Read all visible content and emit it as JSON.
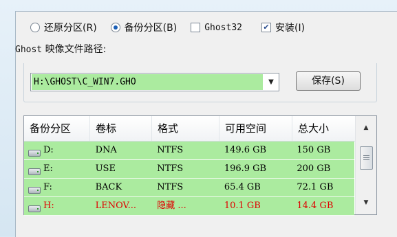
{
  "options": {
    "restore_label": "还原分区(R)",
    "backup_label": "备份分区(B)",
    "ghost32_label": "Ghost32",
    "install_label": "安装(I)",
    "selected": "backup",
    "ghost32_checked": false,
    "install_checked": true
  },
  "path": {
    "label_prefix": "Ghost",
    "label_rest": " 映像文件路径:",
    "value": "H:\\GHOST\\C_WIN7.GHO"
  },
  "save_button": "保存(S)",
  "table": {
    "headers": [
      "备份分区",
      "卷标",
      "格式",
      "可用空间",
      "总大小"
    ],
    "rows": [
      {
        "drive": "D:",
        "label": "DNA",
        "format": "NTFS",
        "free": "149.6 GB",
        "total": "150 GB"
      },
      {
        "drive": "E:",
        "label": "USE",
        "format": "NTFS",
        "free": "196.9 GB",
        "total": "200 GB"
      },
      {
        "drive": "F:",
        "label": "BACK",
        "format": "NTFS",
        "free": "65.4 GB",
        "total": "72.1 GB"
      },
      {
        "drive": "H:",
        "label": "LENOV...",
        "format": "隐藏 ...",
        "free": "10.1 GB",
        "total": "14.4 GB"
      }
    ]
  },
  "colors": {
    "selection_green": "#abeb9f",
    "hidden_red": "#e00000"
  },
  "icons": {
    "drive": "hard-drive-icon",
    "dropdown": "chevron-down-icon",
    "scroll_up": "scroll-up-icon",
    "scroll_down": "scroll-down-icon"
  }
}
